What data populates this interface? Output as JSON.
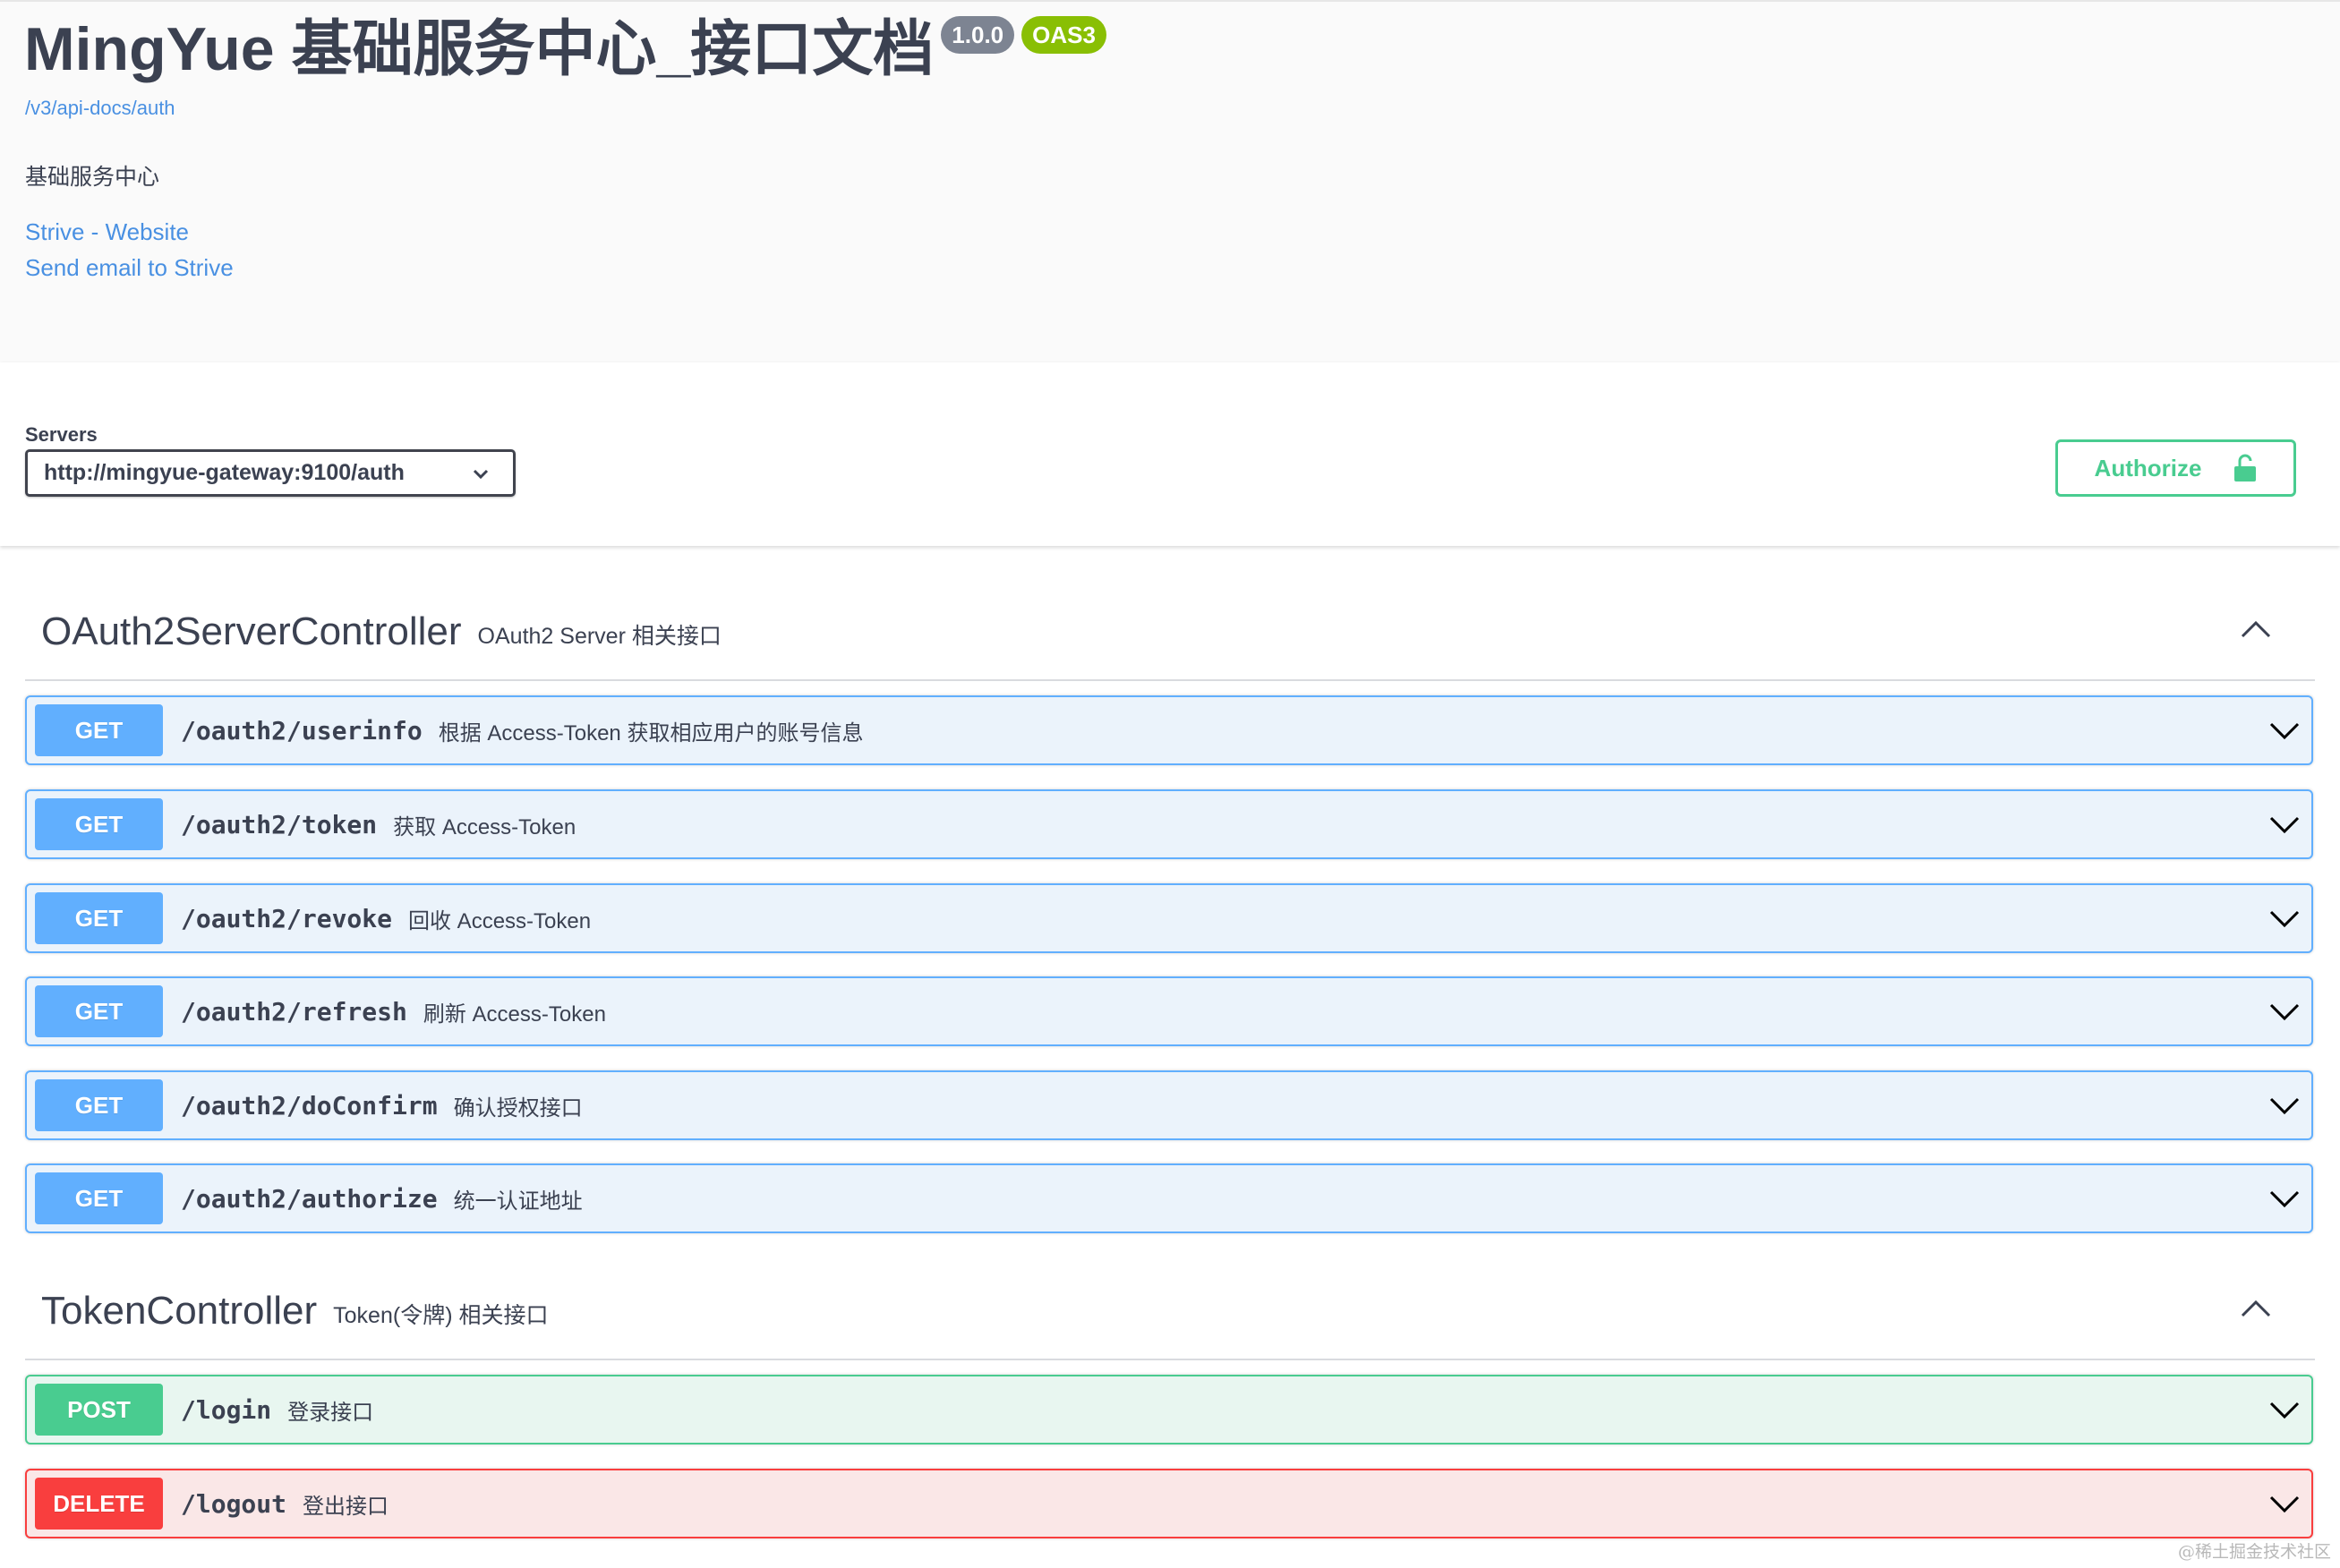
{
  "info": {
    "title": "MingYue 基础服务中心_接口文档",
    "version": "1.0.0",
    "spec": "OAS3",
    "base_url": "/v3/api-docs/auth",
    "description": "基础服务中心",
    "links": [
      "Strive - Website",
      "Send email to Strive"
    ]
  },
  "servers": {
    "label": "Servers",
    "selected": "http://mingyue-gateway:9100/auth"
  },
  "authorize": {
    "label": "Authorize",
    "icon": "unlock-icon",
    "color": "#49cc90"
  },
  "tags": [
    {
      "name": "OAuth2ServerController",
      "description": "OAuth2 Server 相关接口",
      "operations": [
        {
          "method": "GET",
          "path": "/oauth2/userinfo",
          "summary": "根据 Access-Token 获取相应用户的账号信息"
        },
        {
          "method": "GET",
          "path": "/oauth2/token",
          "summary": "获取 Access-Token"
        },
        {
          "method": "GET",
          "path": "/oauth2/revoke",
          "summary": "回收 Access-Token"
        },
        {
          "method": "GET",
          "path": "/oauth2/refresh",
          "summary": "刷新 Access-Token"
        },
        {
          "method": "GET",
          "path": "/oauth2/doConfirm",
          "summary": "确认授权接口"
        },
        {
          "method": "GET",
          "path": "/oauth2/authorize",
          "summary": "统一认证地址"
        }
      ]
    },
    {
      "name": "TokenController",
      "description": "Token(令牌) 相关接口",
      "operations": [
        {
          "method": "POST",
          "path": "/login",
          "summary": "登录接口"
        },
        {
          "method": "DELETE",
          "path": "/logout",
          "summary": "登出接口"
        }
      ]
    }
  ],
  "colors": {
    "get": "#61affe",
    "post": "#49cc90",
    "delete": "#f93e3e",
    "link": "#4990e2"
  },
  "watermark": "@稀土掘金技术社区"
}
